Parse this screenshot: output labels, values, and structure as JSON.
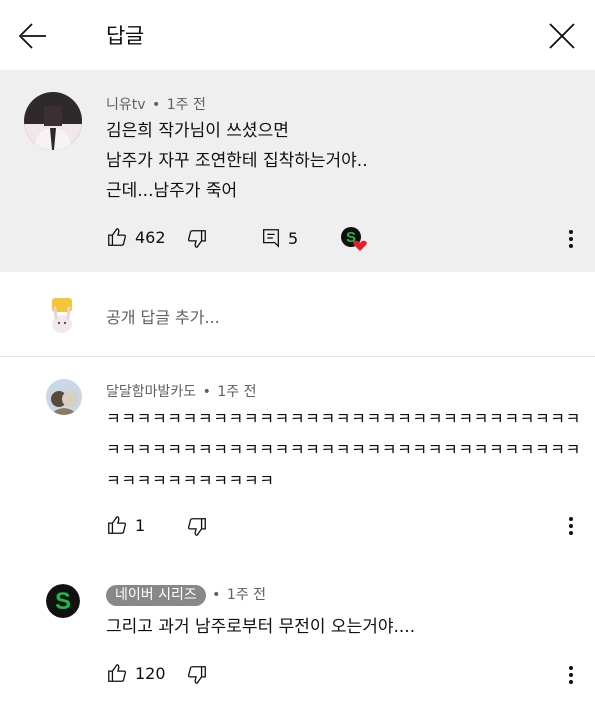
{
  "header": {
    "title": "답글"
  },
  "parent_comment": {
    "author": "니유tv",
    "time": "1주 전",
    "lines": [
      "김은희 작가님이 쓰셨으면",
      "남주가 자꾸 조연한테 집착하는거야..",
      "근데...남주가 죽어"
    ],
    "likes": "462",
    "replies": "5"
  },
  "add_reply": {
    "placeholder": "공개 답글 추가..."
  },
  "replies": [
    {
      "author": "달달함마발카도",
      "time": "1주 전",
      "lines": [
        "ㅋㅋㅋㅋㅋㅋㅋㅋㅋㅋㅋㅋㅋㅋㅋㅋㅋㅋㅋㅋㅋㅋㅋㅋㅋㅋㅋㅋㅋㅋㅋ",
        "ㅋㅋㅋㅋㅋㅋㅋㅋㅋㅋㅋㅋㅋㅋㅋㅋㅋㅋㅋㅋㅋㅋㅋㅋㅋㅋㅋㅋㅋㅋㅋ",
        "ㅋㅋㅋㅋㅋㅋㅋㅋㅋㅋㅋ"
      ],
      "likes": "1"
    },
    {
      "author": "네이버 시리즈",
      "time": "1주 전",
      "lines": [
        "그리고 과거 남주로부터 무전이 오는거야...."
      ],
      "likes": "120"
    }
  ],
  "colors": {
    "heart": "#e5202a",
    "series_green": "#19b94a",
    "creator_badge_bg": "#888888"
  },
  "icons": [
    "back-arrow-icon",
    "close-icon",
    "thumbs-up-icon",
    "thumbs-down-icon",
    "comment-icon",
    "more-vert-icon",
    "creator-heart-icon"
  ]
}
